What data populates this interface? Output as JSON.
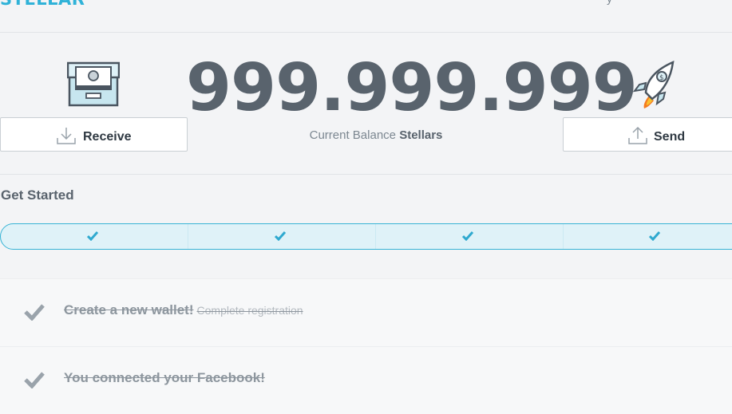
{
  "header": {
    "brand": "STELLAR",
    "right_text": "y"
  },
  "balance": {
    "amount": "999.999.999",
    "label_prefix": "Current Balance",
    "currency": "Stellars"
  },
  "actions": {
    "receive_label": "Receive",
    "send_label": "Send"
  },
  "get_started": {
    "title": "Get Started",
    "steps_completed": 4,
    "steps_total": 4
  },
  "tasks": [
    {
      "title": "Create a new wallet!",
      "subtitle": "Complete registration",
      "done": true
    },
    {
      "title": "You connected your Facebook!",
      "subtitle": "",
      "done": true
    }
  ],
  "colors": {
    "accent": "#2fb2d8",
    "balance": "#59636d",
    "progress_bg": "#dff2f8"
  }
}
